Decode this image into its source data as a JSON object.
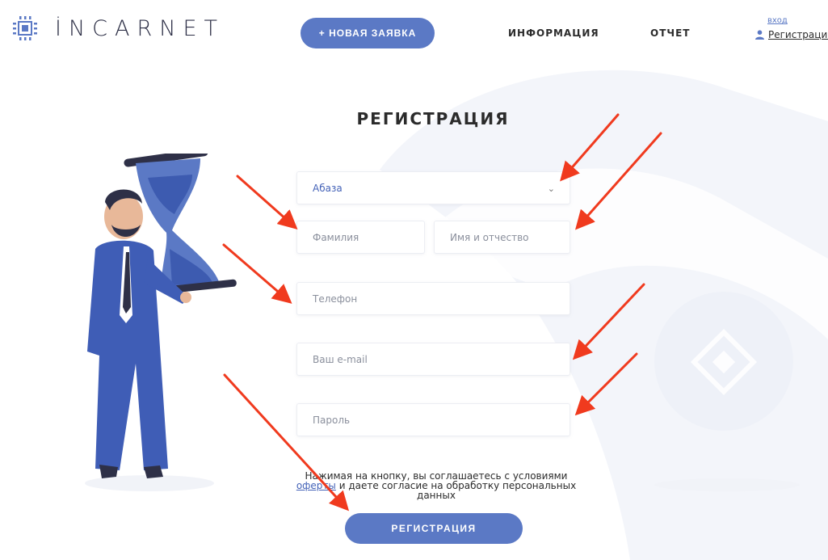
{
  "header": {
    "logo_text": "İNCARNET",
    "new_request_label": "+ НОВАЯ ЗАЯВКА",
    "nav_info_label": "ИНФОРМАЦИЯ",
    "nav_report_label": "ОТЧЕТ",
    "login_label": "вход",
    "register_label": "Регистрация"
  },
  "page": {
    "title": "РЕГИСТРАЦИЯ"
  },
  "form": {
    "city_select_value": "Абаза",
    "lastname_placeholder": "Фамилия",
    "firstname_placeholder": "Имя и отчество",
    "phone_placeholder": "Телефон",
    "email_placeholder": "Ваш e-mail",
    "password_placeholder": "Пароль",
    "consent_line1": "Нажимая на кнопку, вы соглашаетесь с условиями",
    "consent_link": "оферты",
    "consent_line2": " и даете согласие на обработку персональных",
    "consent_line3": "данных",
    "submit_label": "РЕГИСТРАЦИЯ"
  },
  "colors": {
    "accent": "#5b79c5",
    "link": "#4563b8",
    "annotation_arrow": "#f03a1e",
    "bg_decor": "#eef1f8"
  },
  "icons": {
    "logo": "chip-icon",
    "user": "user-icon",
    "select": "chevron-down-icon"
  }
}
